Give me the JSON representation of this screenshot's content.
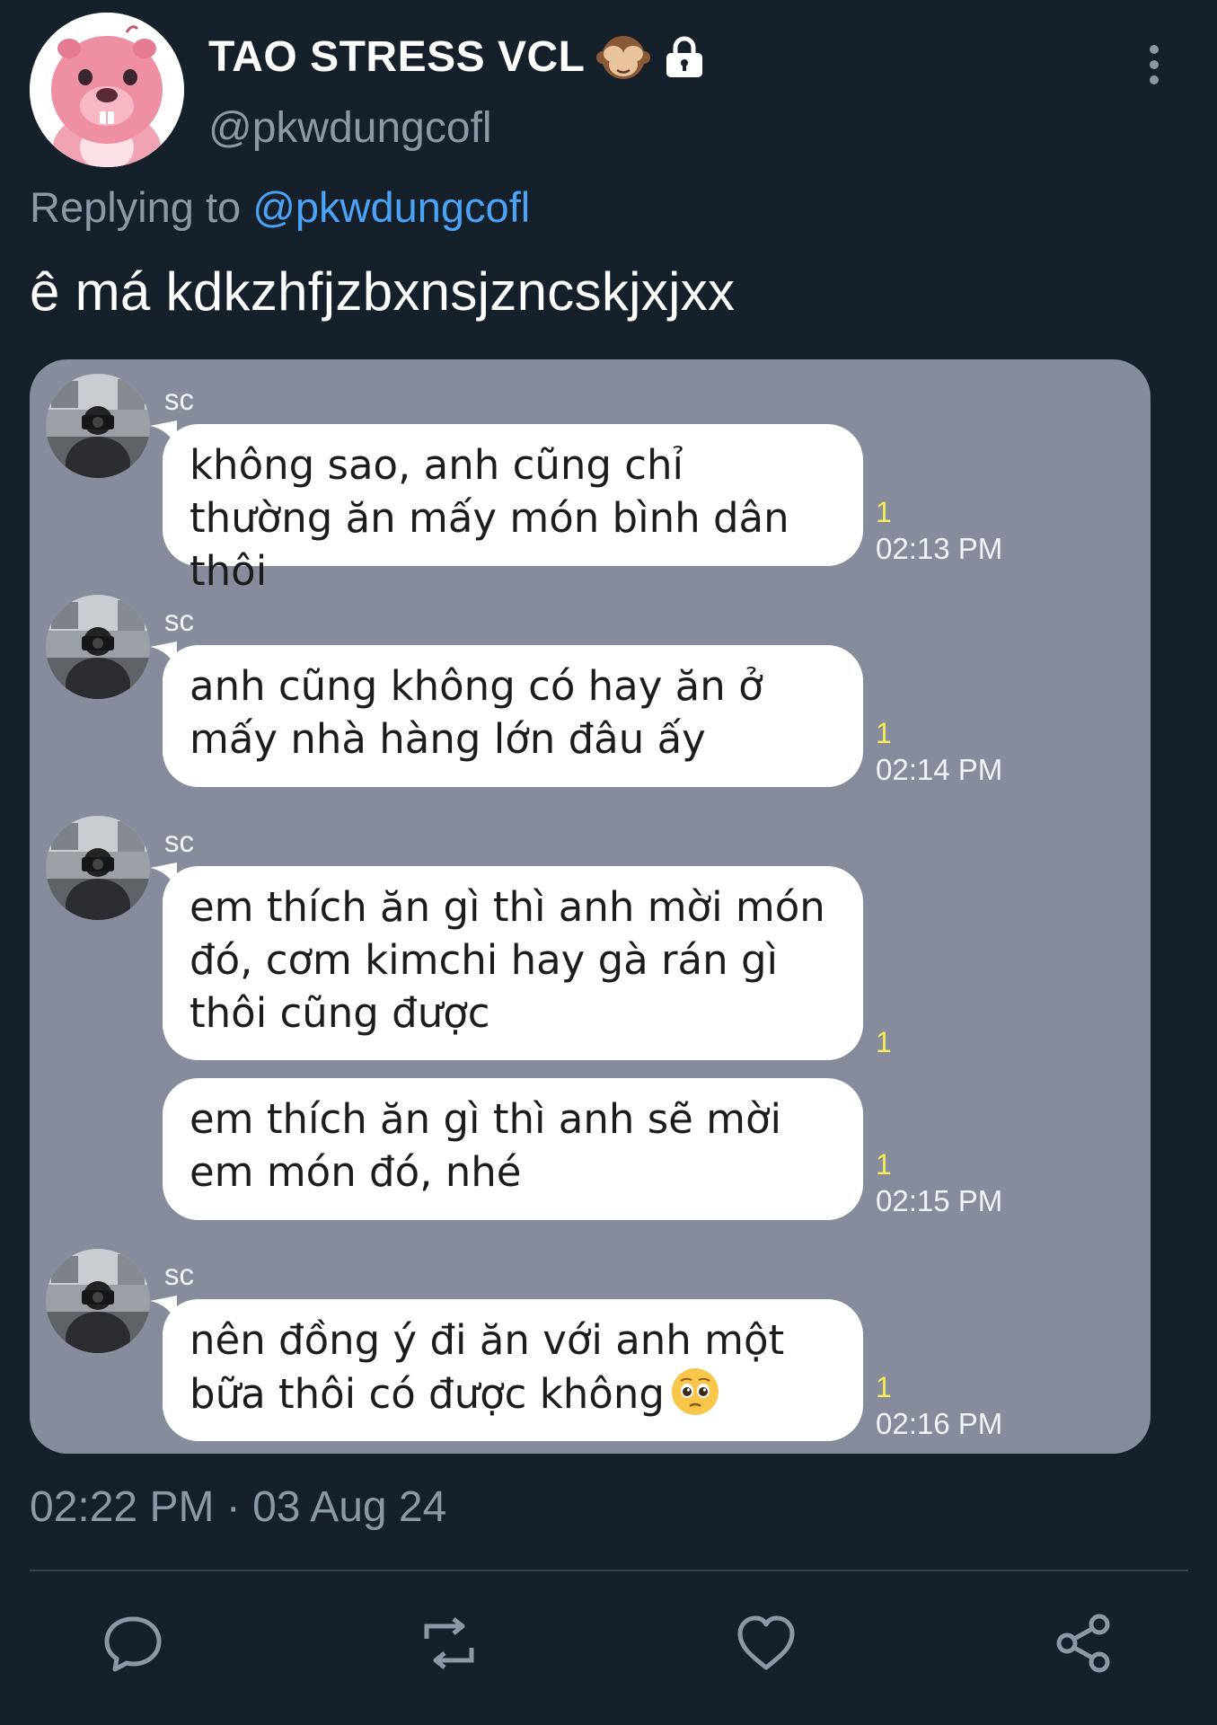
{
  "tweet": {
    "display_name": "TAO STRESS VCL",
    "handle": "@pkwdungcofl",
    "replying_prefix": "Replying to",
    "replying_to": "@pkwdungcofl",
    "text": "ê má kdkzhfjzbxnsjzncskjxjxx",
    "timestamp": "02:22 PM · 03 Aug 24"
  },
  "chat": {
    "messages": [
      {
        "sender": "sc",
        "text": "không sao, anh cũng chỉ thường ăn mấy món bình dân thôi",
        "read_count": "1",
        "time": "02:13 PM"
      },
      {
        "sender": "sc",
        "text": "anh cũng không có hay ăn ở mấy nhà hàng lớn đâu ấy",
        "read_count": "1",
        "time": "02:14 PM"
      },
      {
        "sender": "sc",
        "text": "em thích ăn gì thì anh mời món đó, cơm kimchi hay gà rán gì thôi cũng được",
        "read_count": "1",
        "time": ""
      },
      {
        "sender": "",
        "text": "em thích ăn gì thì anh sẽ mời em món đó, nhé",
        "read_count": "1",
        "time": "02:15 PM"
      },
      {
        "sender": "sc",
        "text": "nên đồng ý đi ăn với anh một bữa thôi có được không",
        "read_count": "1",
        "time": "02:16 PM"
      }
    ]
  },
  "icons": {
    "name_emoji": "see-no-evil-monkey",
    "protected": "lock-icon",
    "menu": "more-vertical-icon",
    "actions": [
      "reply-icon",
      "retweet-icon",
      "like-icon",
      "share-icon"
    ],
    "message_emoji": "pleading-face"
  },
  "colors": {
    "background": "#15202b",
    "secondary_text": "#8b98a5",
    "mention": "#4aa3f5",
    "chat_background": "#878c9d",
    "read_count": "#f5ea5a"
  }
}
